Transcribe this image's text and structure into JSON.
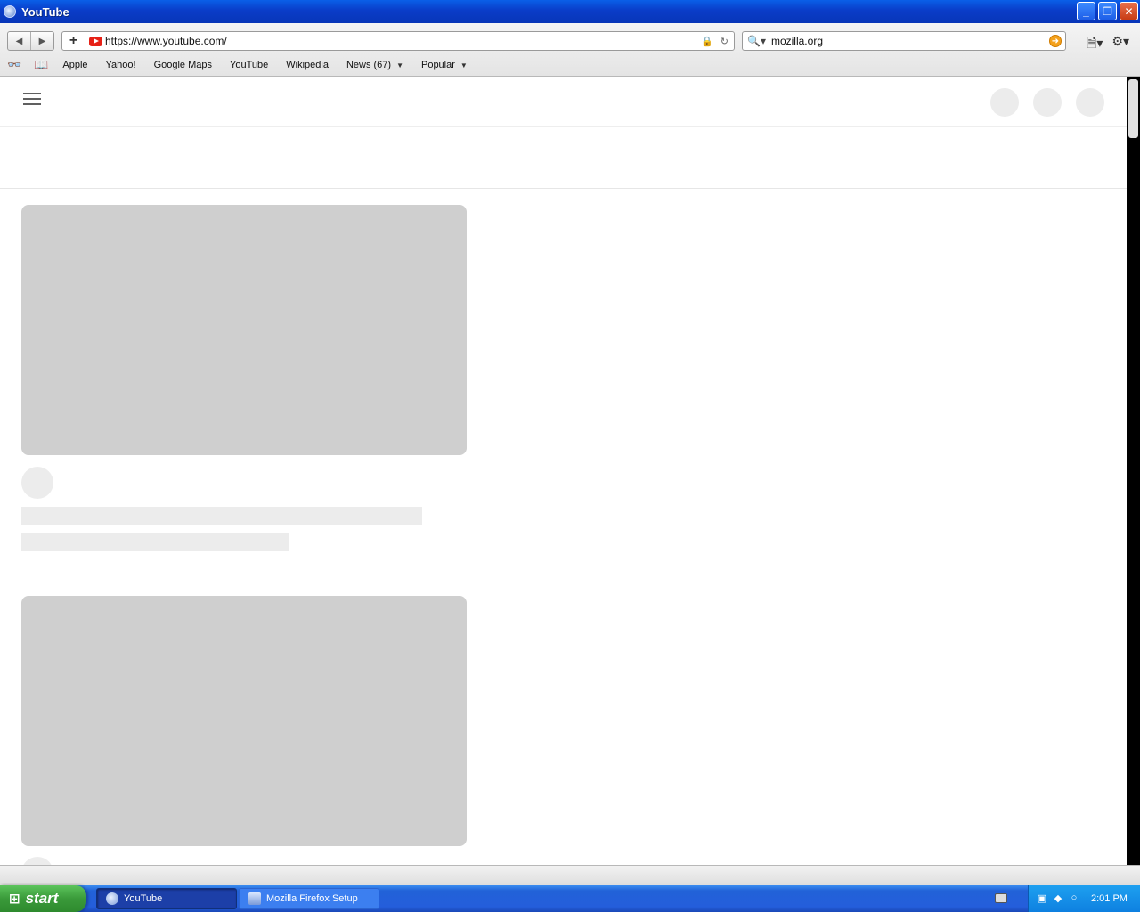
{
  "window": {
    "title": "YouTube",
    "minimize": "_",
    "maximize": "❐",
    "close": "✕"
  },
  "toolbar": {
    "back": "◀",
    "forward": "▶",
    "new_tab": "+",
    "url": "https://www.youtube.com/",
    "lock_icon": "🔒",
    "reload_icon": "↻",
    "search_icon": "🔍▾",
    "search_value": "mozilla.org",
    "search_go": "➜",
    "page_menu": "🗎▾",
    "settings_menu": "⚙▾"
  },
  "bookmarks": {
    "reading_list_icon": "👓",
    "bookmarks_icon": "📖",
    "items": [
      {
        "label": "Apple"
      },
      {
        "label": "Yahoo!"
      },
      {
        "label": "Google Maps"
      },
      {
        "label": "YouTube"
      },
      {
        "label": "Wikipedia"
      },
      {
        "label": "News (67)",
        "dropdown": "▼"
      },
      {
        "label": "Popular",
        "dropdown": "▼"
      }
    ]
  },
  "taskbar": {
    "start_label": "start",
    "start_flag": "⊞",
    "tasks": [
      {
        "label": "YouTube",
        "active": true
      },
      {
        "label": "Mozilla Firefox Setup",
        "active": false
      }
    ],
    "clock": "2:01 PM"
  },
  "colors": {
    "titlebar": "#0a3cc8",
    "placeholder_thumb": "#cfcfcf",
    "placeholder_light": "#ececec",
    "taskbar": "#245edb",
    "start_button": "#3a9a3a"
  }
}
